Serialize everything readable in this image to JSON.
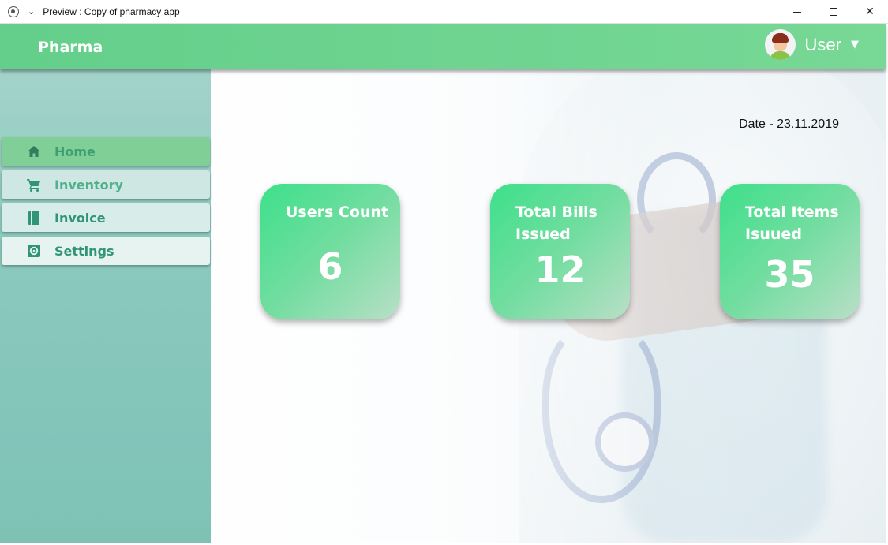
{
  "window": {
    "title": "Preview : Copy of pharmacy app"
  },
  "header": {
    "brand": "Pharma",
    "user_label": "User",
    "user_caret": "▼"
  },
  "sidebar": {
    "items": [
      {
        "label": "Home",
        "icon": "home-icon",
        "active": true
      },
      {
        "label": "Inventory",
        "icon": "cart-icon"
      },
      {
        "label": "Invoice",
        "icon": "book-icon"
      },
      {
        "label": "Settings",
        "icon": "gear-icon"
      }
    ]
  },
  "main": {
    "date": "Date - 23.11.2019",
    "cards": [
      {
        "title": "Users Count",
        "value": "6"
      },
      {
        "title": "Total Bills Issued",
        "value": "12"
      },
      {
        "title": "Total Items Isuued",
        "value": "35"
      }
    ]
  },
  "colors": {
    "header": "#6fd58f",
    "sidebar": "#8ac9be",
    "card": "#3de08b",
    "nav_active": "#7fcf97"
  }
}
